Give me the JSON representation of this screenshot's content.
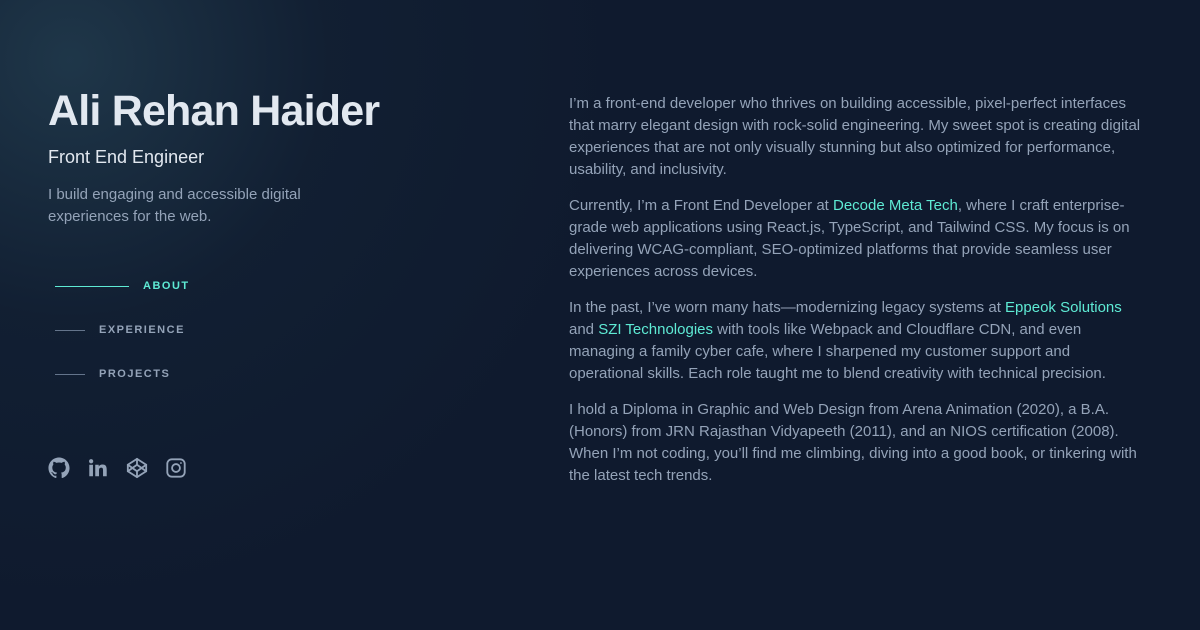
{
  "profile": {
    "name": "Ali Rehan Haider",
    "role": "Front End Engineer",
    "tagline": "I build engaging and accessible digital experiences for the web."
  },
  "nav": {
    "items": [
      {
        "label": "ABOUT",
        "active": true
      },
      {
        "label": "EXPERIENCE",
        "active": false
      },
      {
        "label": "PROJECTS",
        "active": false
      }
    ]
  },
  "socials": [
    {
      "icon": "github-icon"
    },
    {
      "icon": "linkedin-icon"
    },
    {
      "icon": "codepen-icon"
    },
    {
      "icon": "instagram-icon"
    }
  ],
  "about": {
    "p1": "I’m a front-end developer who thrives on building accessible, pixel-perfect interfaces that marry elegant design with rock-solid engineering. My sweet spot is creating digital experiences that are not only visually stunning but also optimized for performance, usability, and inclusivity.",
    "p2": {
      "before": "Currently, I’m a Front End Developer at ",
      "link": "Decode Meta Tech",
      "after": ", where I craft enterprise-grade web applications using React.js, TypeScript, and Tailwind CSS. My focus is on delivering WCAG-compliant, SEO-optimized platforms that provide seamless user experiences across devices."
    },
    "p3": {
      "before": "In the past, I’ve worn many hats—modernizing legacy systems at ",
      "link1": "Eppeok Solutions",
      "middle": " and ",
      "link2": "SZI Technologies",
      "after": " with tools like Webpack and Cloudflare CDN, and even managing a family cyber cafe, where I sharpened my customer support and operational skills. Each role taught me to blend creativity with technical precision."
    },
    "p4": "I hold a Diploma in Graphic and Web Design from Arena Animation (2020), a B.A. (Honors) from JRN Rajasthan Vidyapeeth (2011), and an NIOS certification (2008). When I’m not coding, you’ll find me climbing, diving into a good book, or tinkering with the latest tech trends."
  },
  "colors": {
    "background": "#0f1a2e",
    "accent": "#5eead4",
    "heading": "#e2e8f0",
    "body_text": "#94a3b8"
  }
}
